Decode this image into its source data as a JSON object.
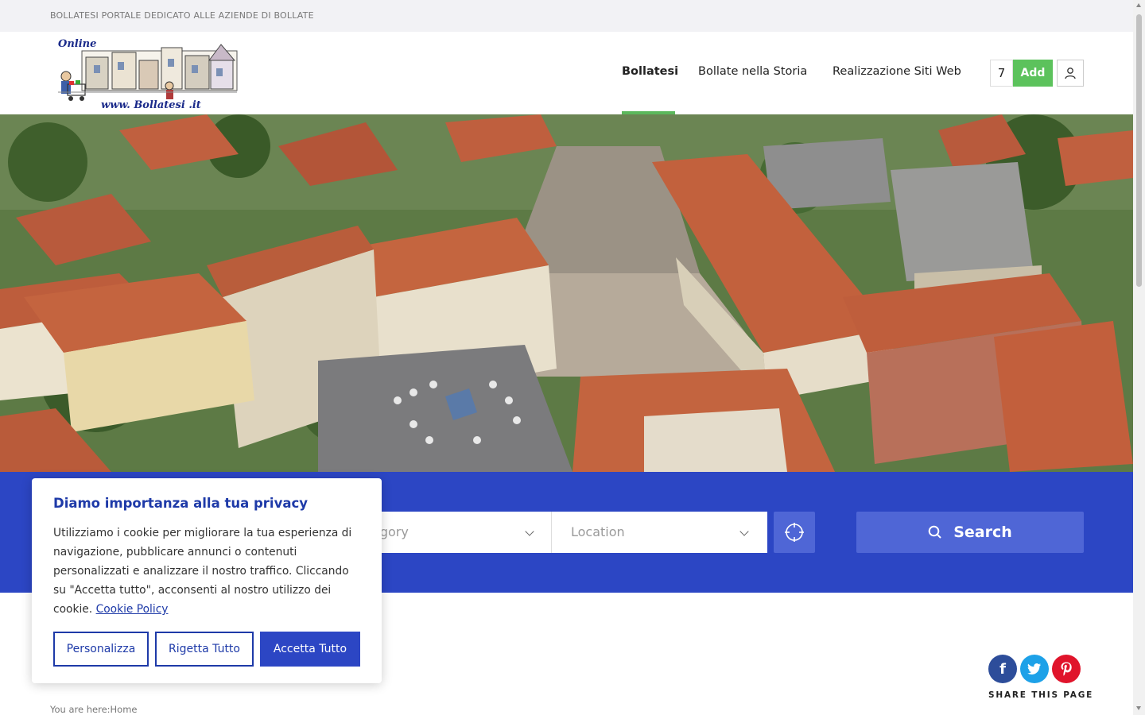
{
  "topbar": {
    "text": "BOLLATESI PORTALE DEDICATO ALLE AZIENDE DI BOLLATE"
  },
  "logo": {
    "top_word": "Online",
    "url_text": "www. Bollatesi .it"
  },
  "nav": {
    "items": [
      {
        "label": "Bollatesi",
        "active": true
      },
      {
        "label": "Bollate nella Storia",
        "active": false
      },
      {
        "label": "Realizzazione Siti Web",
        "active": false
      }
    ],
    "counter": "7",
    "add_label": "Add",
    "user_icon": "user-icon",
    "accent_color": "#5cb85c"
  },
  "search": {
    "category_placeholder": "Category",
    "category_visible": "egory",
    "location_placeholder": "Location",
    "search_label": "Search",
    "band_color": "#2c46c4"
  },
  "page": {
    "breadcrumb_prefix": "You are here:",
    "breadcrumb_home": "Home",
    "share_label": "SHARE THIS PAGE",
    "share_icons": [
      "facebook-icon",
      "twitter-icon",
      "pinterest-icon"
    ]
  },
  "cookie": {
    "title": "Diamo importanza alla tua privacy",
    "body": "Utilizziamo i cookie per migliorare la tua esperienza di navigazione, pubblicare annunci o contenuti personalizzati e analizzare il nostro traffico. Cliccando su \"Accetta tutto\", acconsenti al nostro utilizzo dei cookie. ",
    "link": "Cookie Policy",
    "customize_label": "Personalizza",
    "reject_label": "Rigetta Tutto",
    "accept_label": "Accetta Tutto"
  }
}
